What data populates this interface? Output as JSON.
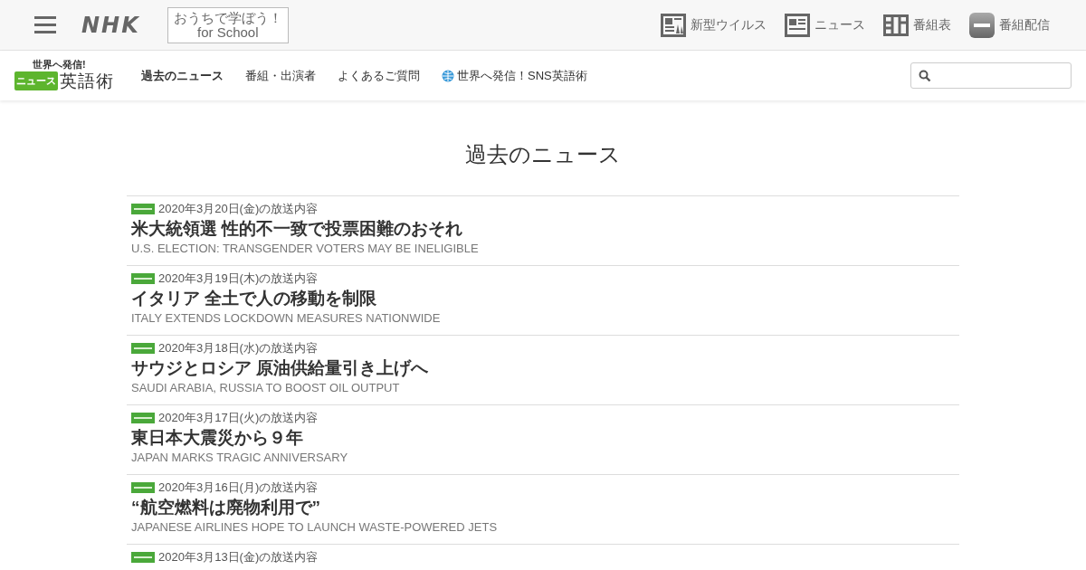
{
  "header": {
    "logo": "NHK",
    "school_link": [
      "おうちで学ぼう！",
      "for School"
    ],
    "links": [
      {
        "kind": "virus",
        "label": "新型ウイルス"
      },
      {
        "kind": "news",
        "label": "ニュース"
      },
      {
        "kind": "schedule",
        "label": "番組表"
      },
      {
        "kind": "stream",
        "label": "番組配信"
      }
    ]
  },
  "program_nav": {
    "logo_top": "世界へ発信!",
    "logo_badge": "ニュース",
    "logo_main": "英語術",
    "items": [
      {
        "label": "過去のニュース",
        "selected": true,
        "kind": "text"
      },
      {
        "label": "番組・出演者",
        "selected": false,
        "kind": "text"
      },
      {
        "label": "よくあるご質問",
        "selected": false,
        "kind": "text"
      },
      {
        "label": "世界へ発信！SNS英語術",
        "selected": false,
        "kind": "globe"
      }
    ]
  },
  "page_title": "過去のニュース",
  "news": [
    {
      "date": "2020年3月20日(金)の放送内容",
      "title": "米大統領選 性的不一致で投票困難のおそれ",
      "english": "U.S. ELECTION: TRANSGENDER VOTERS MAY BE INELIGIBLE"
    },
    {
      "date": "2020年3月19日(木)の放送内容",
      "title": "イタリア 全土で人の移動を制限",
      "english": "ITALY EXTENDS LOCKDOWN MEASURES NATIONWIDE"
    },
    {
      "date": "2020年3月18日(水)の放送内容",
      "title": "サウジとロシア 原油供給量引き上げへ",
      "english": "SAUDI ARABIA, RUSSIA TO BOOST OIL OUTPUT"
    },
    {
      "date": "2020年3月17日(火)の放送内容",
      "title": "東日本大震災から９年",
      "english": "JAPAN MARKS TRAGIC ANNIVERSARY"
    },
    {
      "date": "2020年3月16日(月)の放送内容",
      "title": "“航空燃料は廃物利用で”",
      "english": "JAPANESE AIRLINES HOPE TO LAUNCH WASTE-POWERED JETS"
    },
    {
      "date": "2020年3月13日(金)の放送内容"
    }
  ]
}
